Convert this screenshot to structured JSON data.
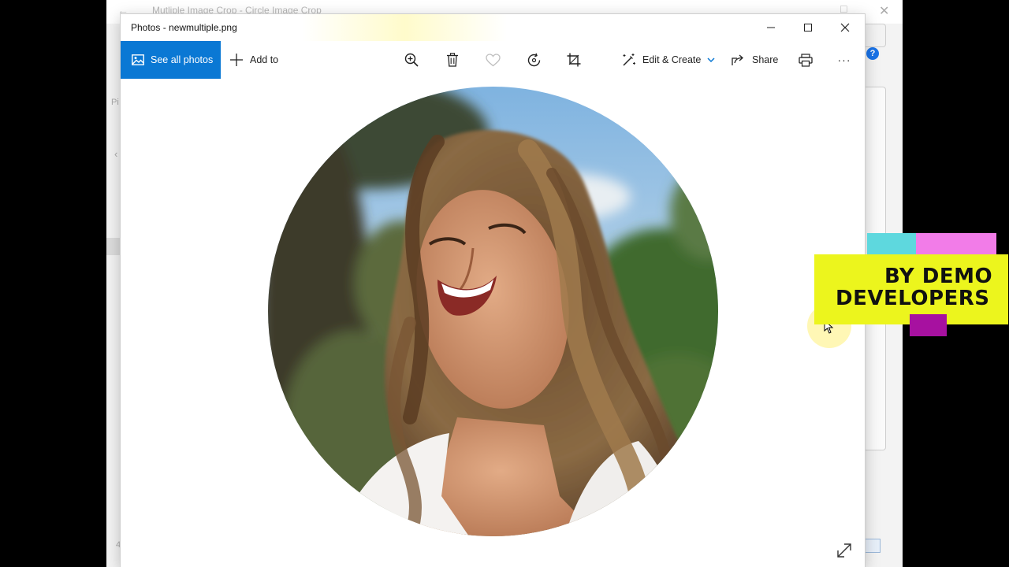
{
  "background_window": {
    "title": "Mutliple Image Crop - Circle Image Crop",
    "help_glyph": "?",
    "left_label": "Pi",
    "left_number": "4"
  },
  "photos_window": {
    "title": "Photos - newmultiple.png",
    "toolbar": {
      "see_all_photos": "See all photos",
      "add_to": "Add to",
      "edit_create": "Edit & Create",
      "share": "Share",
      "more": "···"
    }
  },
  "watermark": {
    "line1": "BY DEMO",
    "line2": "DEVELOPERS"
  },
  "colors": {
    "accent": "#0a78d4",
    "watermark_yellow": "#ecf51d",
    "watermark_pink": "#f27ce8",
    "watermark_cyan": "#5ed8de",
    "watermark_purple": "#a711a0"
  }
}
